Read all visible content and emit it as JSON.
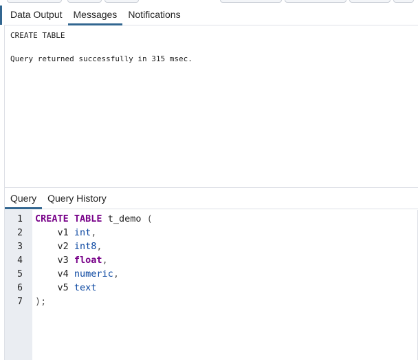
{
  "results_tabs": [
    {
      "label": "Data Output",
      "active": false
    },
    {
      "label": "Messages",
      "active": true
    },
    {
      "label": "Notifications",
      "active": false
    }
  ],
  "messages": {
    "line1": "CREATE TABLE",
    "line2": "Query returned successfully in 315 msec."
  },
  "editor_tabs": [
    {
      "label": "Query",
      "active": true
    },
    {
      "label": "Query History",
      "active": false
    }
  ],
  "code_lines": [
    {
      "number": "1",
      "tokens": [
        {
          "t": "CREATE",
          "c": "kw"
        },
        {
          "t": " ",
          "c": "id"
        },
        {
          "t": "TABLE",
          "c": "kw"
        },
        {
          "t": " t_demo ",
          "c": "id"
        },
        {
          "t": "(",
          "c": "pun"
        }
      ]
    },
    {
      "number": "2",
      "tokens": [
        {
          "t": "    v1 ",
          "c": "id"
        },
        {
          "t": "int",
          "c": "ty"
        },
        {
          "t": ",",
          "c": "pun"
        }
      ]
    },
    {
      "number": "3",
      "tokens": [
        {
          "t": "    v2 ",
          "c": "id"
        },
        {
          "t": "int8",
          "c": "ty"
        },
        {
          "t": ",",
          "c": "pun"
        }
      ]
    },
    {
      "number": "4",
      "tokens": [
        {
          "t": "    v3 ",
          "c": "id"
        },
        {
          "t": "float",
          "c": "kw"
        },
        {
          "t": ",",
          "c": "pun"
        }
      ]
    },
    {
      "number": "5",
      "tokens": [
        {
          "t": "    v4 ",
          "c": "id"
        },
        {
          "t": "numeric",
          "c": "ty"
        },
        {
          "t": ",",
          "c": "pun"
        }
      ]
    },
    {
      "number": "6",
      "tokens": [
        {
          "t": "    v5 ",
          "c": "id"
        },
        {
          "t": "text",
          "c": "ty"
        }
      ]
    },
    {
      "number": "7",
      "tokens": [
        {
          "t": ");",
          "c": "pun"
        }
      ]
    }
  ],
  "colors": {
    "accent": "#326690",
    "keyword": "#770088",
    "type": "#0b47a1",
    "gutter": "#eaedf2"
  }
}
